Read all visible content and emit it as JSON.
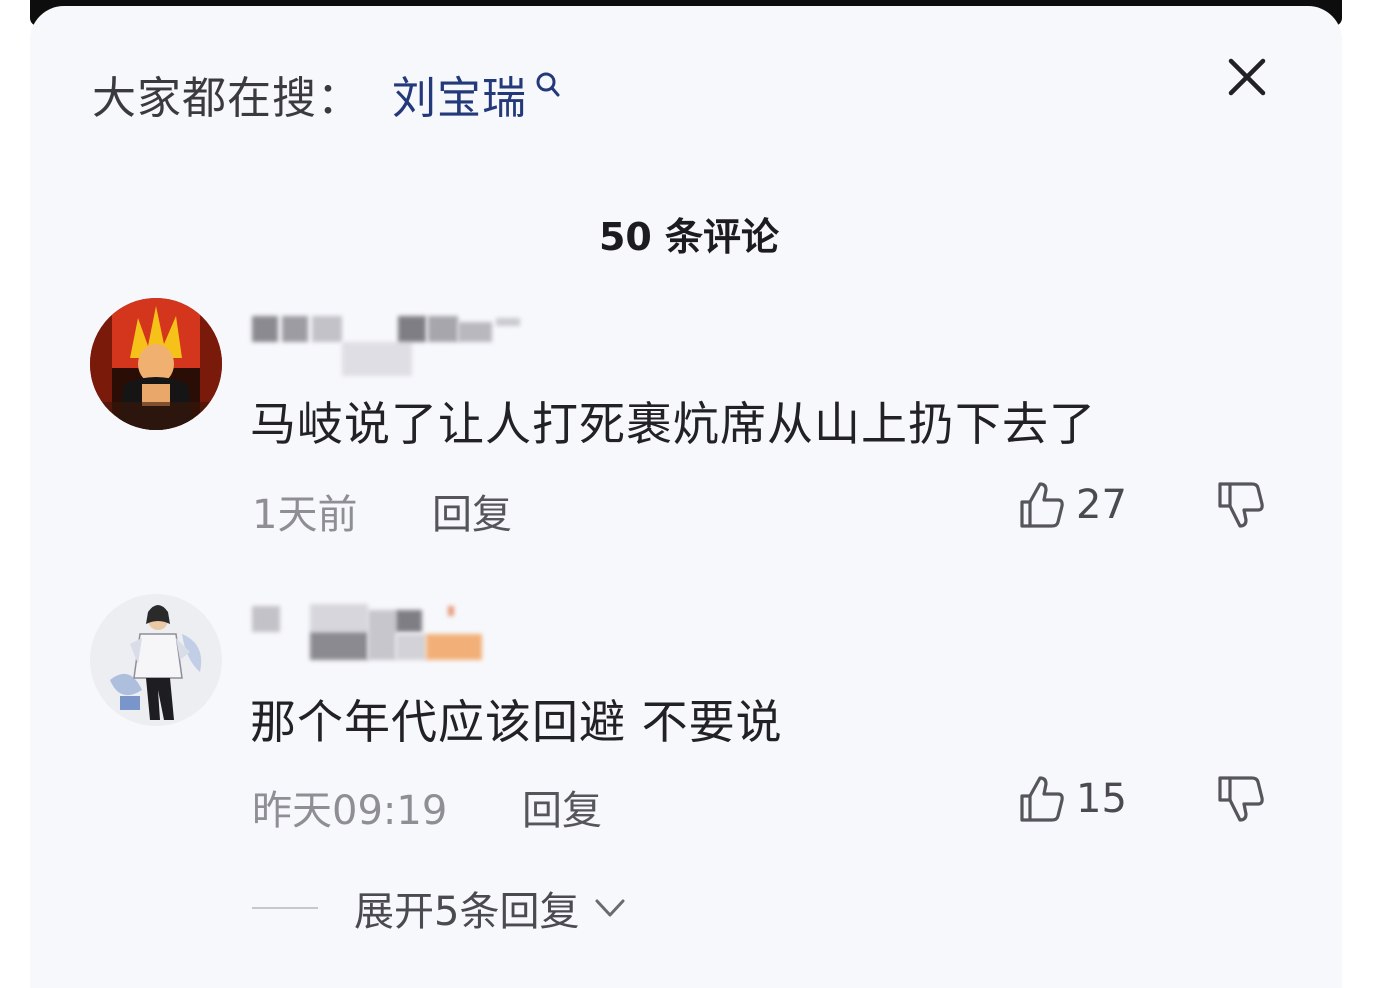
{
  "search": {
    "prefix": "大家都在搜：",
    "term": "刘宝瑞",
    "icon": "search-icon"
  },
  "close": {
    "icon": "close-icon"
  },
  "comments": {
    "title": "50 条评论",
    "items": [
      {
        "text": "马岐说了让人打死裹炕席从山上扔下去了",
        "time": "1天前",
        "reply_label": "回复",
        "likes": "27"
      },
      {
        "text": "那个年代应该回避 不要说",
        "time": "昨天09:19",
        "reply_label": "回复",
        "likes": "15"
      }
    ],
    "expand_label": "展开5条回复"
  },
  "colors": {
    "panel_bg": "#f7f8fc",
    "search_term": "#23397a",
    "text_primary": "#222226",
    "text_meta": "#8e8e94"
  }
}
